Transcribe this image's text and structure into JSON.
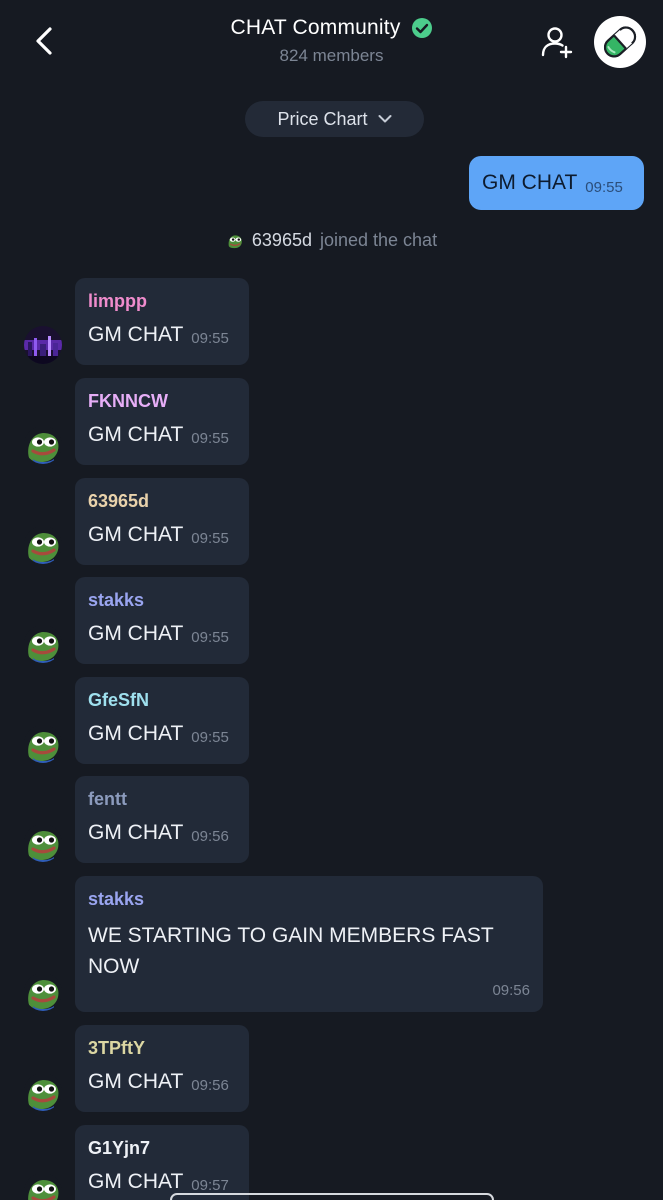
{
  "header": {
    "title": "CHAT Community",
    "subtitle": "824 members"
  },
  "price_chart": {
    "label": "Price Chart"
  },
  "outgoing": {
    "text": "GM CHAT",
    "time": "09:55"
  },
  "join_notice": {
    "name": "63965d",
    "text": "joined the chat"
  },
  "colors": {
    "background": "#161a22",
    "bubble": "#222a38",
    "outgoing_bubble": "#5ea5f7",
    "verified": "#4ccd8c"
  },
  "messages": [
    {
      "sender": "limppp",
      "color": "#f08ccd",
      "text": "GM CHAT",
      "time": "09:55",
      "avatar": "purple-avatar"
    },
    {
      "sender": "FKNNCW",
      "color": "#e7aef7",
      "text": "GM CHAT",
      "time": "09:55",
      "avatar": "pepe-avatar"
    },
    {
      "sender": "63965d",
      "color": "#e9d2ab",
      "text": "GM CHAT",
      "time": "09:55",
      "avatar": "pepe-avatar"
    },
    {
      "sender": "stakks",
      "color": "#9aa5f0",
      "text": "GM CHAT",
      "time": "09:55",
      "avatar": "pepe-avatar"
    },
    {
      "sender": "GfeSfN",
      "color": "#9fe0ee",
      "text": "GM CHAT",
      "time": "09:55",
      "avatar": "pepe-avatar"
    },
    {
      "sender": "fentt",
      "color": "#8c9bbd",
      "text": "GM CHAT",
      "time": "09:56",
      "avatar": "pepe-avatar"
    },
    {
      "sender": "stakks",
      "color": "#9aa5f0",
      "text": "WE STARTING TO GAIN MEMBERS FAST NOW",
      "time": "09:56",
      "avatar": "pepe-avatar"
    },
    {
      "sender": "3TPftY",
      "color": "#dcd7a3",
      "text": "GM CHAT",
      "time": "09:56",
      "avatar": "pepe-avatar"
    },
    {
      "sender": "G1Yjn7",
      "color": "#eef1f6",
      "text": "GM CHAT",
      "time": "09:57",
      "avatar": "pepe-avatar"
    }
  ]
}
